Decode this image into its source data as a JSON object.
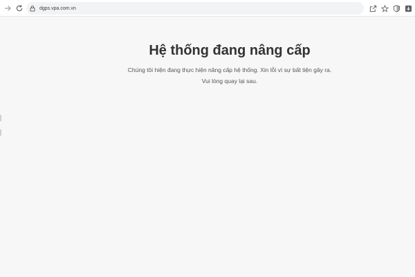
{
  "browser": {
    "url": "dgps.vpa.com.vn",
    "icons": {
      "forward": "arrow-right-icon",
      "reload": "reload-icon",
      "site_info": "lock-icon",
      "share": "share-icon",
      "bookmark": "star-icon",
      "extension": "shield-icon",
      "download": "download-icon"
    }
  },
  "page": {
    "title": "Hệ thống đang nâng cấp",
    "message_line1": "Chúng tôi hiện đang thực hiện nâng cấp hệ thống. Xin lỗi vì sự bất tiện gây ra.",
    "message_line2": "Vui lòng quay lại sau."
  },
  "colors": {
    "page_background": "#f7f7f7",
    "title_text": "#333333",
    "body_text": "#555555"
  }
}
